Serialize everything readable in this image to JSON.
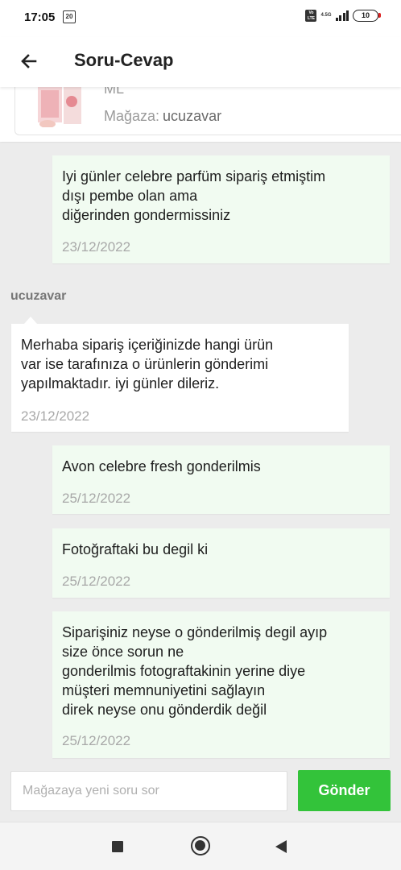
{
  "status_bar": {
    "time": "17:05",
    "notification_badge": "20",
    "network_badge": "Vo LTE",
    "network_label": "4.5G",
    "battery_level": "10"
  },
  "header": {
    "title": "Soru-Cevap"
  },
  "product": {
    "name_tail": "ML",
    "store_label": "Mağaza:",
    "store_name": "ucuzavar"
  },
  "messages": [
    {
      "from": "customer",
      "text": "Iyi günler celebre parfüm sipariş etmiştim\ndışı pembe olan ama\ndiğerinden gondermissiniz",
      "date": "23/12/2022"
    },
    {
      "from": "seller",
      "sender": "ucuzavar",
      "text": "Merhaba sipariş içeriğinizde hangi ürün\nvar ise tarafınıza o ürünlerin gönderimi\nyapılmaktadır. iyi günler dileriz.",
      "date": "23/12/2022"
    },
    {
      "from": "customer",
      "text": "Avon celebre fresh gonderilmis",
      "date": "25/12/2022"
    },
    {
      "from": "customer",
      "text": "Fotoğraftaki bu degil ki",
      "date": "25/12/2022"
    },
    {
      "from": "customer",
      "text": "Siparişiniz neyse o gönderilmiş degil ayıp\nsize önce sorun ne\ngonderilmis fotograftakinin yerine diye\nmüşteri memnuniyetini sağlayın\ndirek neyse onu gönderdik değil",
      "date": "25/12/2022"
    }
  ],
  "compose": {
    "placeholder": "Mağazaya yeni soru sor",
    "value": "",
    "send_label": "Gönder"
  },
  "colors": {
    "accent": "#33c33a",
    "customer_bubble": "#f1fbf1",
    "seller_bubble": "#ffffff",
    "background": "#ececec"
  }
}
